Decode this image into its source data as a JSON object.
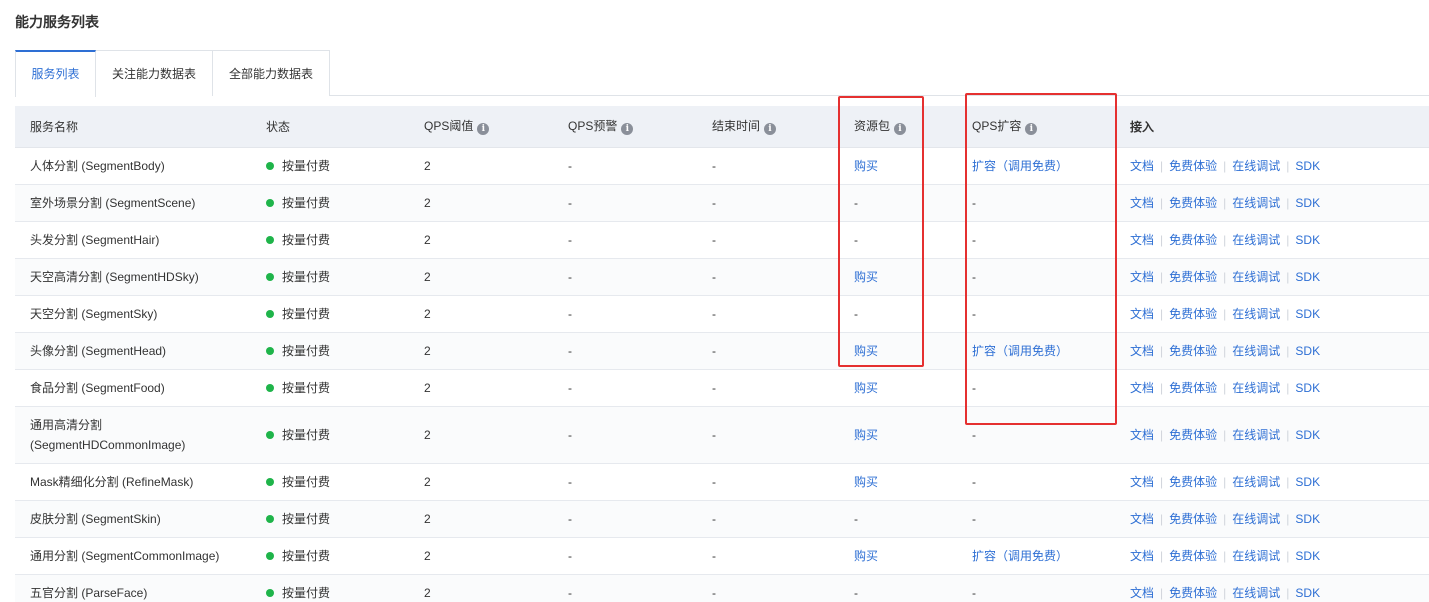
{
  "page_title": "能力服务列表",
  "tabs": [
    {
      "label": "服务列表",
      "active": true
    },
    {
      "label": "关注能力数据表",
      "active": false
    },
    {
      "label": "全部能力数据表",
      "active": false
    }
  ],
  "columns": {
    "name": "服务名称",
    "status": "状态",
    "qps_limit": "QPS阈值",
    "qps_alert": "QPS预警",
    "end_time": "结束时间",
    "package": "资源包",
    "qps_expand": "QPS扩容",
    "access": "接入"
  },
  "access_links": {
    "doc": "文档",
    "trial": "免费体验",
    "debug": "在线调试",
    "sdk": "SDK"
  },
  "rows": [
    {
      "name": "人体分割 (SegmentBody)",
      "status": "按量付费",
      "qps": "2",
      "alert": "-",
      "end": "-",
      "package": "购买",
      "expand": "扩容（调用免费）"
    },
    {
      "name": "室外场景分割 (SegmentScene)",
      "status": "按量付费",
      "qps": "2",
      "alert": "-",
      "end": "-",
      "package": "-",
      "expand": "-"
    },
    {
      "name": "头发分割 (SegmentHair)",
      "status": "按量付费",
      "qps": "2",
      "alert": "-",
      "end": "-",
      "package": "-",
      "expand": "-"
    },
    {
      "name": "天空高清分割 (SegmentHDSky)",
      "status": "按量付费",
      "qps": "2",
      "alert": "-",
      "end": "-",
      "package": "购买",
      "expand": "-"
    },
    {
      "name": "天空分割 (SegmentSky)",
      "status": "按量付费",
      "qps": "2",
      "alert": "-",
      "end": "-",
      "package": "-",
      "expand": "-"
    },
    {
      "name": "头像分割 (SegmentHead)",
      "status": "按量付费",
      "qps": "2",
      "alert": "-",
      "end": "-",
      "package": "购买",
      "expand": "扩容（调用免费）"
    },
    {
      "name": "食品分割 (SegmentFood)",
      "status": "按量付费",
      "qps": "2",
      "alert": "-",
      "end": "-",
      "package": "购买",
      "expand": "-"
    },
    {
      "name": "通用高清分割 (SegmentHDCommonImage)",
      "status": "按量付费",
      "qps": "2",
      "alert": "-",
      "end": "-",
      "package": "购买",
      "expand": "-"
    },
    {
      "name": "Mask精细化分割 (RefineMask)",
      "status": "按量付费",
      "qps": "2",
      "alert": "-",
      "end": "-",
      "package": "购买",
      "expand": "-"
    },
    {
      "name": "皮肤分割 (SegmentSkin)",
      "status": "按量付费",
      "qps": "2",
      "alert": "-",
      "end": "-",
      "package": "-",
      "expand": "-"
    },
    {
      "name": "通用分割 (SegmentCommonImage)",
      "status": "按量付费",
      "qps": "2",
      "alert": "-",
      "end": "-",
      "package": "购买",
      "expand": "扩容（调用免费）"
    },
    {
      "name": "五官分割 (ParseFace)",
      "status": "按量付费",
      "qps": "2",
      "alert": "-",
      "end": "-",
      "package": "-",
      "expand": "-"
    }
  ],
  "colors": {
    "accent": "#2e6fd4",
    "status_green": "#1fb44a",
    "highlight_red": "#e53030",
    "header_bg": "#eef1f6"
  },
  "icons": {
    "info": "info-circle-icon",
    "status": "status-dot-icon"
  }
}
